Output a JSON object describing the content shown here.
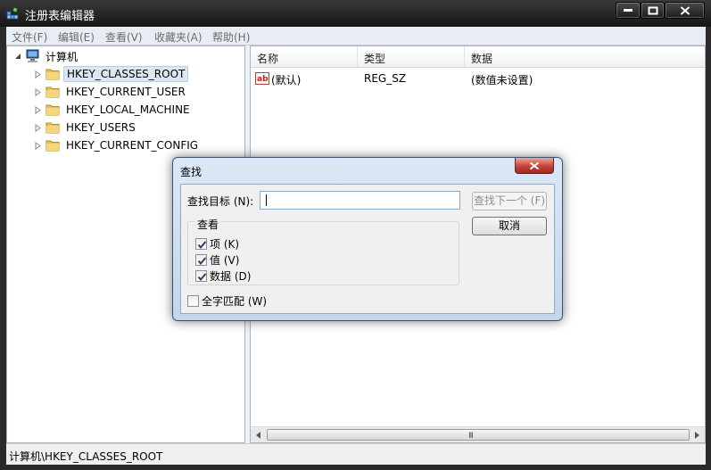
{
  "window": {
    "title": "注册表编辑器"
  },
  "menu": [
    {
      "label": "文件(F)"
    },
    {
      "label": "编辑(E)"
    },
    {
      "label": "查看(V)"
    },
    {
      "label": "收藏夹(A)"
    },
    {
      "label": "帮助(H)"
    }
  ],
  "tree": {
    "root": "计算机",
    "children": [
      {
        "label": "HKEY_CLASSES_ROOT",
        "selected": true
      },
      {
        "label": "HKEY_CURRENT_USER",
        "selected": false
      },
      {
        "label": "HKEY_LOCAL_MACHINE",
        "selected": false
      },
      {
        "label": "HKEY_USERS",
        "selected": false
      },
      {
        "label": "HKEY_CURRENT_CONFIG",
        "selected": false
      }
    ]
  },
  "list": {
    "columns": [
      "名称",
      "类型",
      "数据"
    ],
    "rows": [
      {
        "name": "(默认)",
        "type": "REG_SZ",
        "data": "(数值未设置)",
        "icon": "string-value-icon"
      }
    ],
    "scroll_grip": "III"
  },
  "status": {
    "path": "计算机\\HKEY_CLASSES_ROOT"
  },
  "find_dialog": {
    "title": "查找",
    "target_label": "查找目标 (N):",
    "target_value": "",
    "find_next_label": "查找下一个 (F)",
    "cancel_label": "取消",
    "look_at_title": "查看",
    "options": [
      {
        "label": "项 (K)",
        "checked": true
      },
      {
        "label": "值 (V)",
        "checked": true
      },
      {
        "label": "数据 (D)",
        "checked": true
      }
    ],
    "match_whole": {
      "label": "全字匹配 (W)",
      "checked": false
    }
  },
  "colors": {
    "selection": "#dde7f3",
    "folder": "#e8c25a",
    "dialog_frame": "#c3d6ec",
    "close_button": "#c5433a"
  }
}
